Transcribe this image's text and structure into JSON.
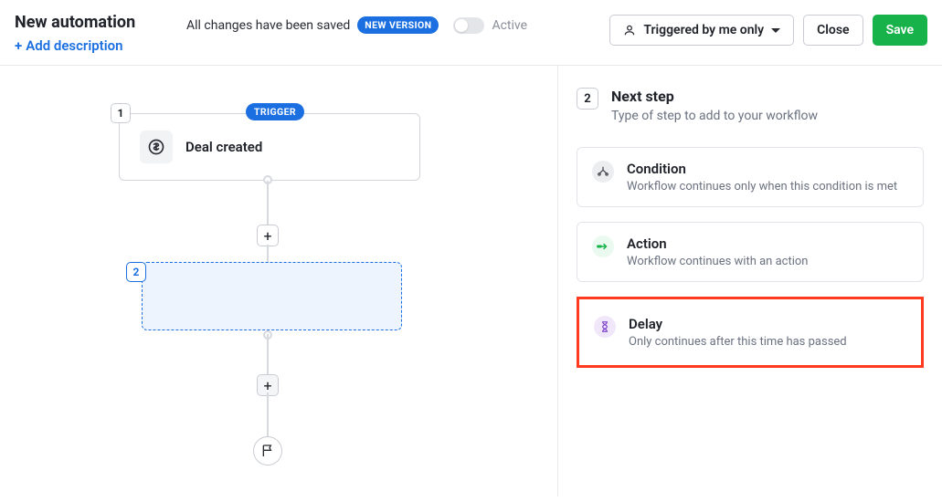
{
  "header": {
    "title": "New automation",
    "add_description": "Add description",
    "saved": "All changes have been saved",
    "version_badge": "NEW VERSION",
    "active_label": "Active",
    "visibility": "Triggered by me only",
    "close": "Close",
    "save": "Save"
  },
  "canvas": {
    "trigger_badge": "TRIGGER",
    "step1_num": "1",
    "step1_label": "Deal created",
    "step2_num": "2"
  },
  "sidebar": {
    "step_num": "2",
    "title": "Next step",
    "subtitle": "Type of step to add to your workflow",
    "options": [
      {
        "title": "Condition",
        "desc": "Workflow continues only when this condition is met"
      },
      {
        "title": "Action",
        "desc": "Workflow continues with an action"
      },
      {
        "title": "Delay",
        "desc": "Only continues after this time has passed"
      }
    ]
  }
}
